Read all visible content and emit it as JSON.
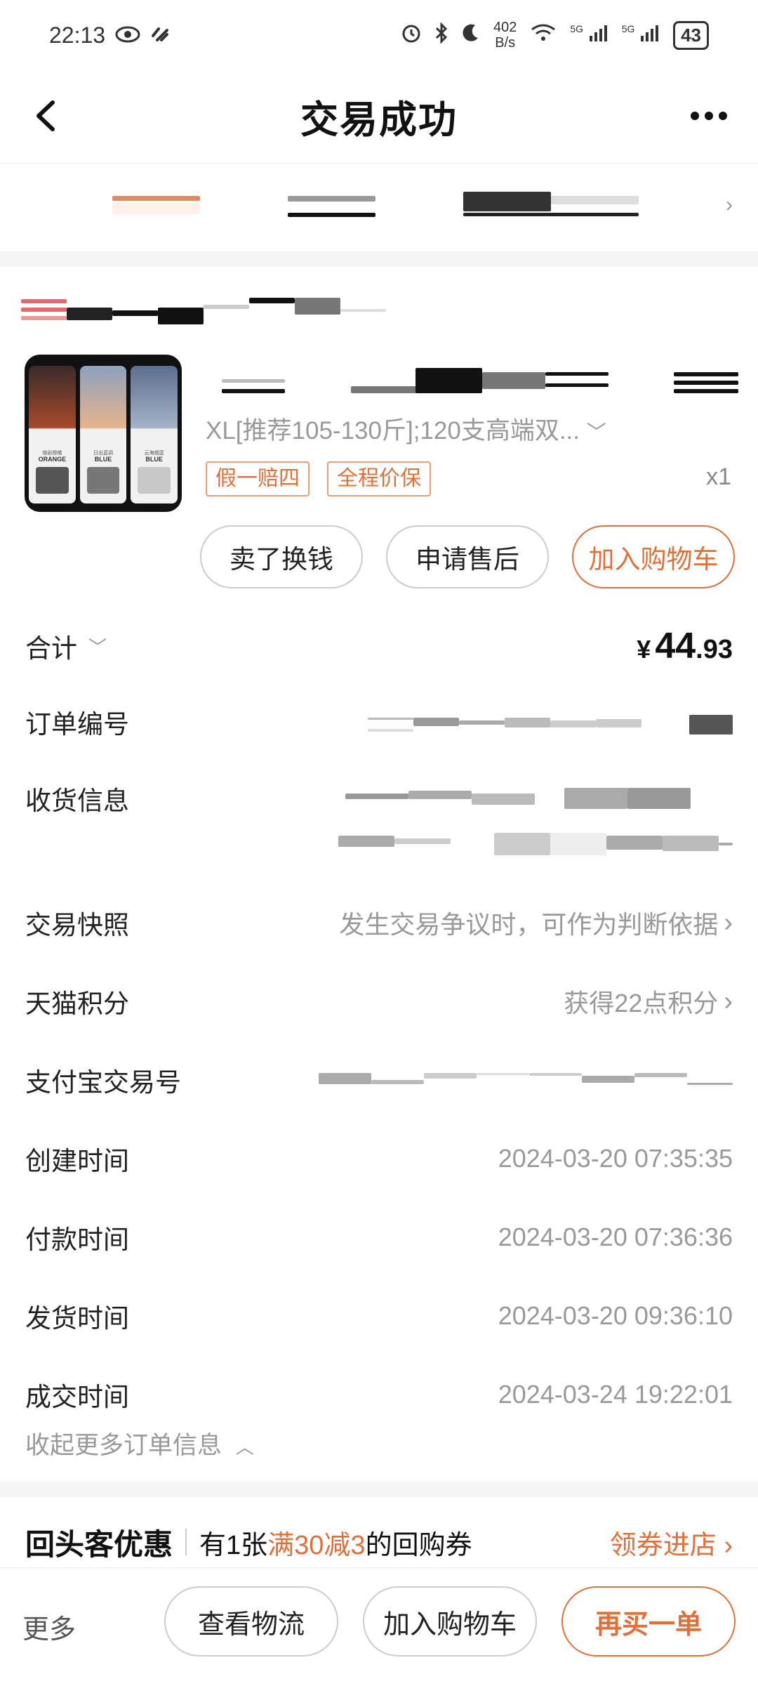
{
  "status_bar": {
    "time": "22:13",
    "speed_value": "402",
    "speed_unit": "B/s",
    "network_1": "5G",
    "network_2": "5G",
    "battery": "43"
  },
  "header": {
    "title": "交易成功"
  },
  "product": {
    "panels": [
      {
        "label": "ORANGE",
        "sub": "熔岩橙橘"
      },
      {
        "label": "BLUE",
        "sub": "日出蓝调"
      },
      {
        "label": "BLUE",
        "sub": "云海烟蓝"
      }
    ],
    "sku": "XL[推荐105-130斤];120支高端双...",
    "tags": [
      "假一赔四",
      "全程价保"
    ],
    "quantity": "x1",
    "actions": [
      "卖了换钱",
      "申请售后",
      "加入购物车"
    ]
  },
  "order": {
    "total_label": "合计",
    "total_symbol": "¥",
    "total_int": "44",
    "total_dec": ".93",
    "order_no_label": "订单编号",
    "shipping_label": "收货信息",
    "snapshot_label": "交易快照",
    "snapshot_value": "发生交易争议时，可作为判断依据",
    "points_label": "天猫积分",
    "points_value": "获得22点积分",
    "alipay_label": "支付宝交易号",
    "created_label": "创建时间",
    "created_value": "2024-03-20 07:35:35",
    "paid_label": "付款时间",
    "paid_value": "2024-03-20 07:36:36",
    "shipped_label": "发货时间",
    "shipped_value": "2024-03-20 09:36:10",
    "closed_label": "成交时间",
    "closed_value": "2024-03-24 19:22:01",
    "collapse_label": "收起更多订单信息"
  },
  "promo": {
    "title": "回头客优惠",
    "text_before": "有1张",
    "highlight": "满30减3",
    "text_after": "的回购券",
    "action": "领券进店"
  },
  "bottom_bar": {
    "more": "更多",
    "buttons": [
      "查看物流",
      "加入购物车",
      "再买一单"
    ]
  },
  "colors": {
    "accent": "#e0703a",
    "muted_text": "#999999",
    "background_gap": "#f5f5f5"
  }
}
